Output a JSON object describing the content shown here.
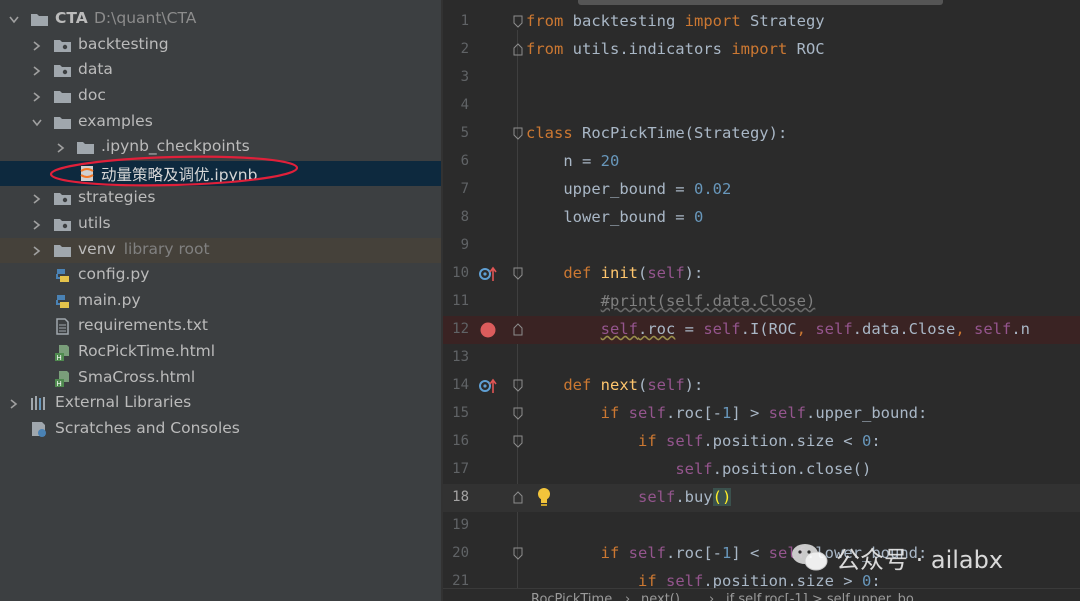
{
  "project_tree": {
    "root": {
      "name": "CTA",
      "path": "D:\\quant\\CTA"
    },
    "items": [
      {
        "label": "backtesting"
      },
      {
        "label": "data"
      },
      {
        "label": "doc"
      },
      {
        "label": "examples"
      },
      {
        "label": ".ipynb_checkpoints"
      },
      {
        "label": "动量策略及调优.ipynb"
      },
      {
        "label": "strategies"
      },
      {
        "label": "utils"
      },
      {
        "label": "venv",
        "hint": "library root"
      },
      {
        "label": "config.py"
      },
      {
        "label": "main.py"
      },
      {
        "label": "requirements.txt"
      },
      {
        "label": "RocPickTime.html"
      },
      {
        "label": "SmaCross.html"
      },
      {
        "label": "External Libraries"
      },
      {
        "label": "Scratches and Consoles"
      }
    ]
  },
  "editor": {
    "line_numbers": [
      "1",
      "2",
      "3",
      "4",
      "5",
      "6",
      "7",
      "8",
      "9",
      "10",
      "11",
      "12",
      "13",
      "14",
      "15",
      "16",
      "17",
      "18",
      "19",
      "20",
      "21"
    ],
    "current_line": "18",
    "breakpoint_line": "12"
  },
  "breadcrumb": {
    "items": [
      "RocPickTime",
      "next()",
      "if self.roc[-1] > self.upper_bo"
    ],
    "separator": "›"
  },
  "watermark": {
    "text": "公众号 · ailabx"
  },
  "colors": {
    "project_bg": "#3c3f41",
    "editor_bg": "#2b2b2b",
    "selection": "#0d293e",
    "keyword": "#cc7832",
    "number": "#6897bb",
    "function": "#ffc66d",
    "self": "#94558d",
    "annotation_red": "#e0203a"
  }
}
